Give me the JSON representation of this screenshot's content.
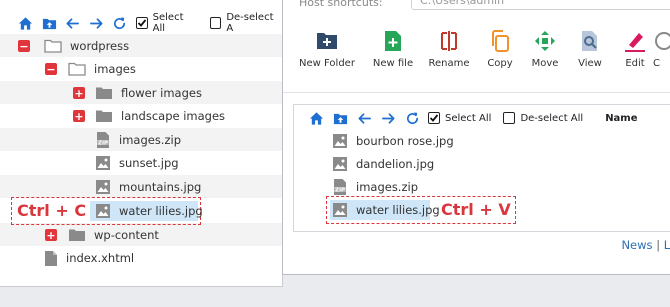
{
  "toolbar": {
    "select_all": "Select All",
    "deselect_all": "De-select A"
  },
  "tree": [
    {
      "label": "wordpress",
      "icon": "folder-icon",
      "expander": "minus"
    },
    {
      "label": "images",
      "icon": "folder-icon",
      "expander": "minus"
    },
    {
      "label": "flower images",
      "icon": "folder-icon",
      "expander": "plus"
    },
    {
      "label": "landscape images",
      "icon": "folder-icon",
      "expander": "plus"
    },
    {
      "label": "images.zip",
      "icon": "zip-file-icon"
    },
    {
      "label": "sunset.jpg",
      "icon": "image-file-icon"
    },
    {
      "label": "mountains.jpg",
      "icon": "image-file-icon"
    },
    {
      "label": "water lilies.jpg",
      "icon": "image-file-icon",
      "selected": true
    },
    {
      "label": "wp-content",
      "icon": "folder-icon",
      "expander": "plus"
    },
    {
      "label": "index.xhtml",
      "icon": "file-icon"
    }
  ],
  "annotations": {
    "copy_shortcut": "Ctrl + C",
    "paste_shortcut": "Ctrl + V"
  },
  "dialog": {
    "shortcut_label": "Host shortcuts:",
    "shortcut_value": "C:\\Users\\admin",
    "actions": [
      {
        "label": "New Folder",
        "icon": "new-folder-icon",
        "color": "#2f4a6b"
      },
      {
        "label": "New file",
        "icon": "new-file-icon",
        "color": "#27a65a"
      },
      {
        "label": "Rename",
        "icon": "rename-icon",
        "color": "#c0392b"
      },
      {
        "label": "Copy",
        "icon": "copy-icon",
        "color": "#f0932b"
      },
      {
        "label": "Move",
        "icon": "move-icon",
        "color": "#27a65a"
      },
      {
        "label": "View",
        "icon": "view-icon",
        "color": "#6f8aa8"
      },
      {
        "label": "Edit",
        "icon": "edit-icon",
        "color": "#d81b60"
      },
      {
        "label": "C",
        "icon": "more-icon",
        "color": "#888888"
      }
    ],
    "file_toolbar": {
      "select_all": "Select All",
      "deselect_all": "De-select All",
      "name_header": "Name"
    },
    "files": [
      {
        "label": "bourbon rose.jpg",
        "icon": "image-file-icon"
      },
      {
        "label": "dandelion.jpg",
        "icon": "image-file-icon"
      },
      {
        "label": "images.zip",
        "icon": "zip-file-icon"
      },
      {
        "label": "water lilies.jpg",
        "icon": "image-file-icon",
        "selected": true
      }
    ],
    "links": {
      "news": "News",
      "separator": "|",
      "next": "Le"
    }
  },
  "colors": {
    "accent_blue": "#1f6fd1",
    "expander_red": "#e0353b",
    "annotation_red": "#d9363e",
    "selection_bg": "#cfe6f8",
    "folder_gray": "#8a8a8a"
  }
}
